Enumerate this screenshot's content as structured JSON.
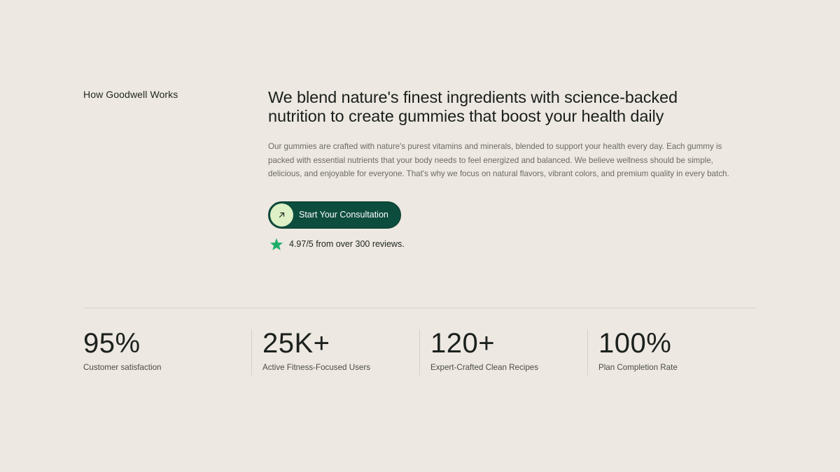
{
  "section": {
    "label": "How Goodwell Works"
  },
  "hero": {
    "headline_line1": "We blend nature's finest ingredients with science-backed",
    "headline_line2": "nutrition to create gummies that boost your health daily",
    "body": "Our gummies are crafted with nature's purest vitamins and minerals, blended to support your health every day. Each gummy is packed with essential nutrients that your body needs to feel energized and balanced. We believe wellness should be simple, delicious, and enjoyable for everyone. That's why we focus on natural flavors, vibrant colors, and premium quality in every batch."
  },
  "cta": {
    "label": "Start Your Consultation",
    "icon": "arrow-up-right-icon"
  },
  "rating": {
    "icon": "star-icon",
    "text": "4.97/5 from over 300 reviews."
  },
  "stats": [
    {
      "value": "95%",
      "label": "Customer satisfaction"
    },
    {
      "value": "25K+",
      "label": "Active Fitness-Focused Users"
    },
    {
      "value": "120+",
      "label": "Expert-Crafted Clean Recipes"
    },
    {
      "value": "100%",
      "label": "Plan Completion Rate"
    }
  ],
  "colors": {
    "background": "#ede8e1",
    "cta_background": "#0d4d3e",
    "cta_icon_circle": "#def0c6",
    "star": "#1fae6a"
  }
}
